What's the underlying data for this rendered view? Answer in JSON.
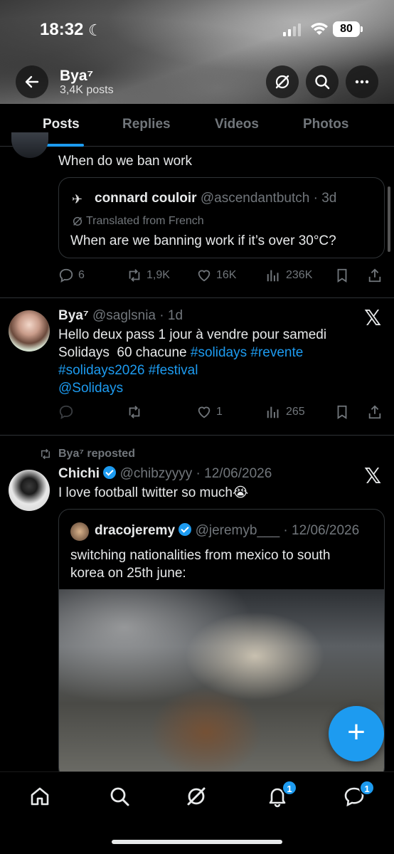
{
  "status": {
    "time": "18:32",
    "battery": "80"
  },
  "profile": {
    "name": "Bya⁷",
    "posts": "3,4K posts"
  },
  "tabs": [
    {
      "label": "Posts"
    },
    {
      "label": "Replies"
    },
    {
      "label": "Videos"
    },
    {
      "label": "Photos"
    }
  ],
  "post1": {
    "text": "When do we ban work",
    "quote": {
      "name": "connard couloir",
      "handle": "@ascendantbutch",
      "time": "3d",
      "translated": "Translated from French",
      "text": "When are we banning work if it’s over 30°C?"
    },
    "actions": {
      "replies": "6",
      "reposts": "1,9K",
      "likes": "16K",
      "views": "236K"
    }
  },
  "post2": {
    "name": "Bya⁷",
    "handle": "@saglsnia",
    "time": "1d",
    "text_line1": "Hello deux pass 1 jour à vendre pour samedi",
    "text_line2_plain": "Solidays  60 chacune ",
    "hashtags_line2": "#solidays #revente",
    "hashtags_line3": "#solidays2026 #festival",
    "mention": "@Solidays",
    "actions": {
      "replies": "",
      "reposts": "",
      "likes": "1",
      "views": "265"
    }
  },
  "post3": {
    "reposted_by": "Bya⁷ reposted",
    "name": "Chichi",
    "handle": "@chibzyyyy",
    "time": "12/06/2026",
    "text": "I love football twitter so much😭",
    "quote": {
      "name": "dracojeremy",
      "handle": "@jeremyb___",
      "time": "12/06/2026",
      "text_line1": "switching nationalities from mexico to south",
      "text_line2": "korea on 25th june:"
    }
  },
  "bottom_nav": {
    "items": [
      "home-icon",
      "search-icon",
      "grok-icon",
      "bell-icon",
      "messages-icon"
    ],
    "notifications_badge": "1",
    "messages_badge": "1"
  },
  "colors": {
    "accent": "#1d9bf0",
    "background": "#000000",
    "muted": "#71767b",
    "text": "#e7e9ea"
  }
}
